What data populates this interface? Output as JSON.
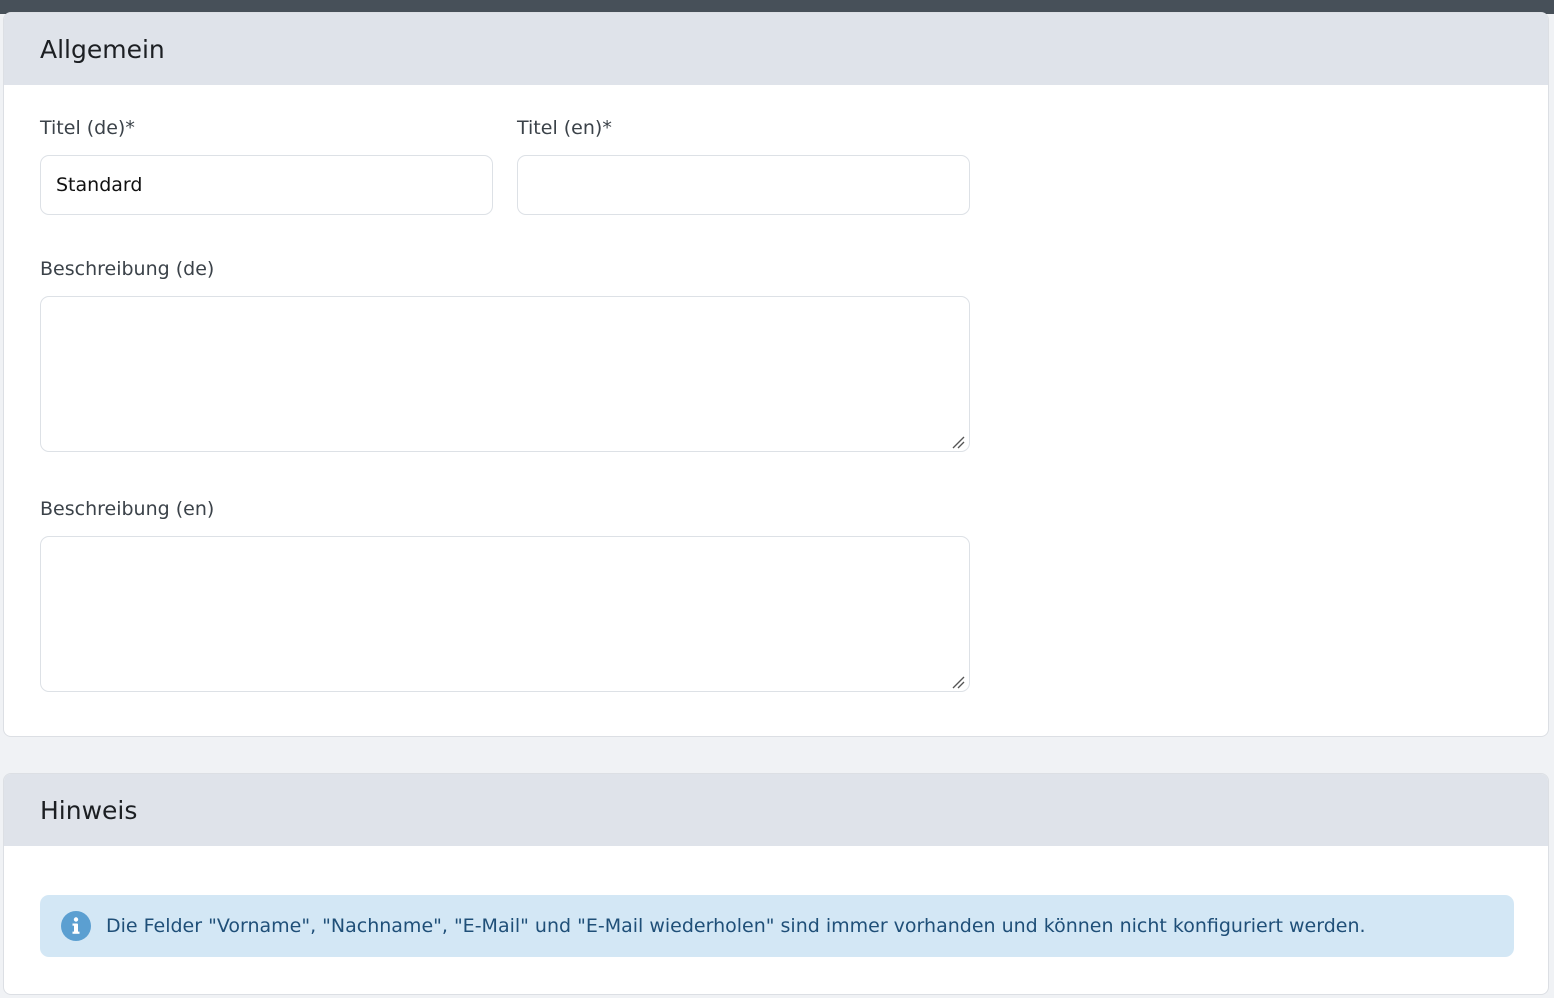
{
  "general": {
    "title": "Allgemein",
    "title_de": {
      "label": "Titel (de)*",
      "value": "Standard",
      "placeholder": ""
    },
    "title_en": {
      "label": "Titel (en)*",
      "value": "",
      "placeholder": ""
    },
    "description_de": {
      "label": "Beschreibung (de)",
      "value": ""
    },
    "description_en": {
      "label": "Beschreibung (en)",
      "value": ""
    }
  },
  "note": {
    "title": "Hinweis",
    "message": "Die Felder \"Vorname\", \"Nachname\", \"E-Mail\" und \"E-Mail wiederholen\" sind immer vorhanden und können nicht konfiguriert werden.",
    "icon": "info-icon"
  },
  "colors": {
    "header_bg": "#dfe3ea",
    "topbar": "#475059",
    "alert_bg": "#d3e7f5",
    "alert_text": "#1f4f78",
    "info_icon": "#5b9fd1"
  }
}
